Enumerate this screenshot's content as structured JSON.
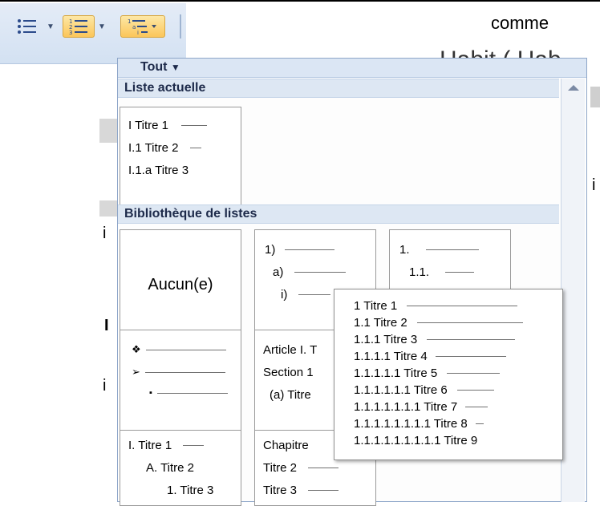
{
  "document": {
    "word": "comme",
    "heading_fragment": "Habit ( Hab",
    "side_marks": [
      "i",
      "I",
      "i",
      "i"
    ]
  },
  "toolbar": {
    "buttons": [
      {
        "name": "bullets",
        "icon": "bullet-list-icon",
        "active": false
      },
      {
        "name": "numbering",
        "icon": "numbered-list-icon",
        "active": true
      },
      {
        "name": "multilevel",
        "icon": "multilevel-list-icon",
        "active": true
      }
    ],
    "active_color": "#fbc65a"
  },
  "dropdown": {
    "filter_label": "Tout",
    "current_section": "Liste actuelle",
    "library_section": "Bibliothèque de listes",
    "current_list": [
      "I Titre 1",
      "I.1 Titre 2",
      "I.1.a Titre 3"
    ],
    "library": [
      {
        "center": "Aucun(e)",
        "rows": []
      },
      {
        "center": "",
        "rows": [
          "1)",
          "a)",
          "i)"
        ]
      },
      {
        "center": "",
        "rows": [
          "1.",
          "1.1.",
          ""
        ]
      },
      {
        "center": "",
        "rows": [
          "❖",
          "➢",
          "▪"
        ]
      },
      {
        "center": "",
        "rows": [
          "Article I. T",
          "Section 1",
          "(a) Titre"
        ]
      },
      {
        "center": "",
        "rows": [
          "",
          "",
          ""
        ]
      },
      {
        "center": "",
        "rows": [
          "I. Titre 1",
          "A. Titre 2",
          "1. Titre 3"
        ]
      },
      {
        "center": "",
        "rows": [
          "Chapitre",
          "Titre 2",
          "Titre 3"
        ]
      }
    ]
  },
  "preview": {
    "rows": [
      "1 Titre 1",
      "1.1 Titre 2",
      "1.1.1 Titre 3",
      "1.1.1.1 Titre 4",
      "1.1.1.1.1 Titre 5",
      "1.1.1.1.1.1 Titre 6",
      "1.1.1.1.1.1.1 Titre 7",
      "1.1.1.1.1.1.1.1 Titre 8",
      "1.1.1.1.1.1.1.1.1 Titre 9"
    ]
  }
}
